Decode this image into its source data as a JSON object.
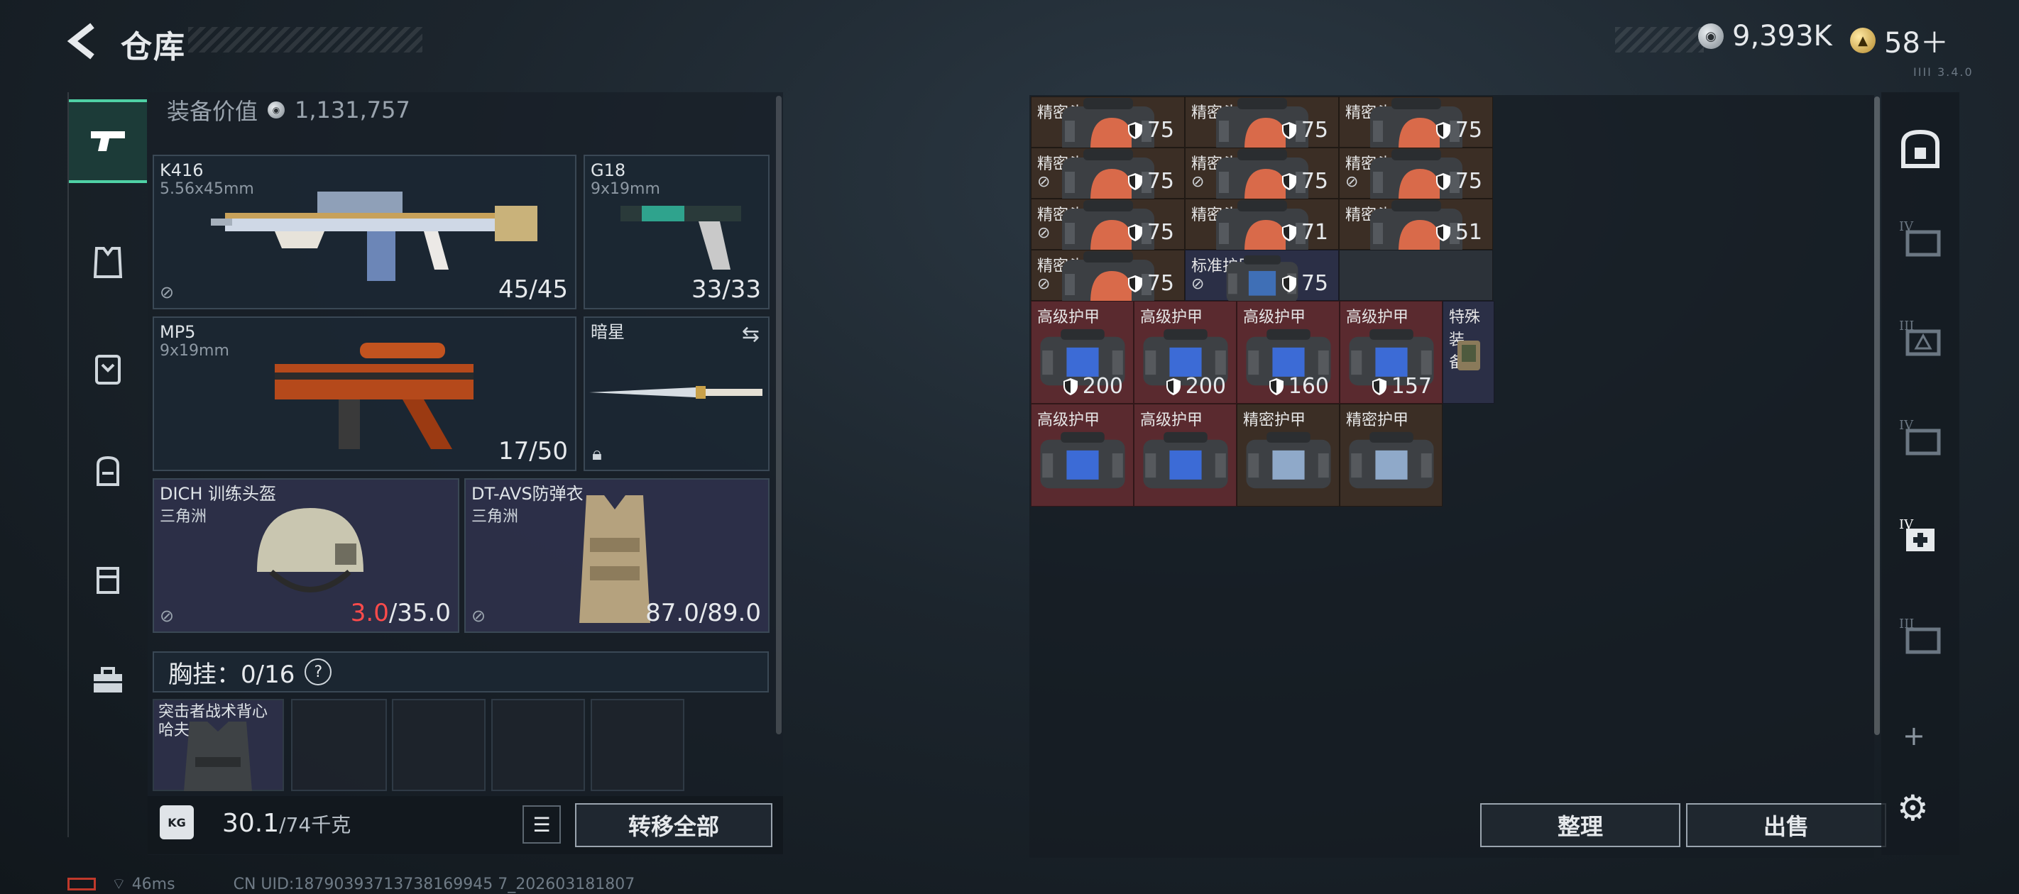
{
  "header": {
    "title": "仓库",
    "silver_amount": "9,393K",
    "gold_amount": "58＋",
    "version": "IIII 3.4.0"
  },
  "equipment": {
    "value_label": "装备价值",
    "value": "1,131,757",
    "weapons": [
      {
        "name": "K416",
        "caliber": "5.56x45mm",
        "ammo": "45/45"
      },
      {
        "name": "G18",
        "caliber": "9x19mm",
        "ammo": "33/33"
      },
      {
        "name": "MP5",
        "caliber": "9x19mm",
        "ammo": "17/50"
      },
      {
        "name": "暗星",
        "caliber": "",
        "ammo": ""
      }
    ],
    "helmet": {
      "name": "DICH 训练头盔",
      "map": "三角洲",
      "durability_current": "3.0",
      "durability_max": "/35.0"
    },
    "armor": {
      "name": "DT-AVS防弹衣",
      "map": "三角洲",
      "durability": "87.0/89.0"
    },
    "chest_rig": {
      "label": "胸挂：0/16",
      "help": "?"
    },
    "rig_item": {
      "name": "突击者战术背心",
      "map": "哈夫克"
    },
    "weight": {
      "current": "30.1",
      "max": "/74千克"
    },
    "transfer_all": "转移全部"
  },
  "status": {
    "ping": "46ms",
    "uid": "CN UID:18790393713738169945 7_202603181807"
  },
  "stash": {
    "sort_button": "整理",
    "sell_button": "出售",
    "rows": [
      [
        {
          "name": "精密头盔",
          "dur": "75",
          "lock": false,
          "color": "brown"
        },
        {
          "name": "精密头盔",
          "dur": "75",
          "lock": false,
          "color": "brown"
        },
        {
          "name": "精密头盔",
          "dur": "75",
          "lock": false,
          "color": "brown"
        }
      ],
      [
        {
          "name": "精密头盔",
          "dur": "75",
          "lock": true,
          "color": "brown"
        },
        {
          "name": "精密头盔",
          "dur": "75",
          "lock": true,
          "color": "brown"
        },
        {
          "name": "精密头盔",
          "dur": "75",
          "lock": true,
          "color": "brown"
        }
      ],
      [
        {
          "name": "精密头盔",
          "dur": "75",
          "lock": true,
          "color": "brown"
        },
        {
          "name": "精密头盔",
          "dur": "71",
          "lock": false,
          "color": "brown"
        },
        {
          "name": "精密头盔",
          "dur": "51",
          "lock": false,
          "color": "brown"
        }
      ],
      [
        {
          "name": "精密头盔",
          "dur": "75",
          "lock": true,
          "color": "brown"
        },
        {
          "name": "标准护甲",
          "dur": "75",
          "lock": true,
          "color": "navy"
        }
      ]
    ],
    "armor_row1": [
      {
        "name": "高级护甲",
        "dur": "200"
      },
      {
        "name": "高级护甲",
        "dur": "200"
      },
      {
        "name": "高级护甲",
        "dur": "160"
      },
      {
        "name": "高级护甲",
        "dur": "157"
      }
    ],
    "special": {
      "name": "特殊装备..."
    },
    "armor_row2": [
      {
        "name": "高级护甲",
        "color": "red"
      },
      {
        "name": "高级护甲",
        "color": "red"
      },
      {
        "name": "精密护甲",
        "color": "brown"
      },
      {
        "name": "精密护甲",
        "color": "brown"
      }
    ]
  },
  "right_rail": [
    "IV",
    "III",
    "IV",
    "IV",
    "III"
  ],
  "colors": {
    "accent": "#4fd1a5",
    "danger": "#ff4b4b",
    "brown_cell": "#3b2e25",
    "red_cell": "#5a2a2f"
  }
}
